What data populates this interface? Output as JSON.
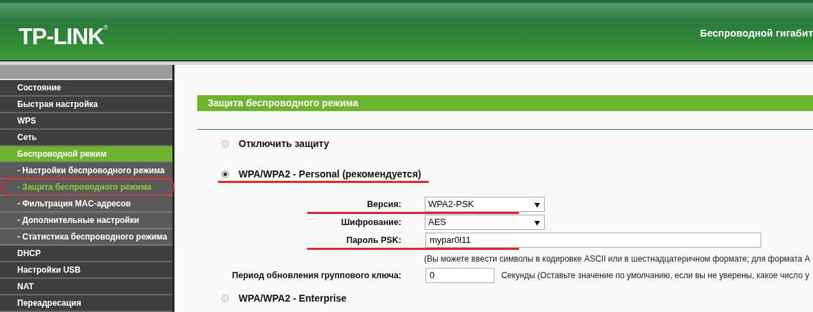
{
  "header": {
    "logo": "TP-LINK",
    "logo_mark": "®",
    "title": "Беспроводной гигабит"
  },
  "sidebar": {
    "items": [
      {
        "label": "Состояние",
        "kind": "main",
        "selected": false,
        "circled": false
      },
      {
        "label": "Быстрая настройка",
        "kind": "main",
        "selected": false,
        "circled": false
      },
      {
        "label": "WPS",
        "kind": "main",
        "selected": false,
        "circled": false
      },
      {
        "label": "Сеть",
        "kind": "main",
        "selected": false,
        "circled": false
      },
      {
        "label": "Беспроводной режим",
        "kind": "main",
        "selected": true,
        "circled": false
      },
      {
        "label": "- Настройки беспроводного режима",
        "kind": "sub",
        "selected": false,
        "circled": false
      },
      {
        "label": "- Защита беспроводного режима",
        "kind": "sub",
        "selected": true,
        "circled": true
      },
      {
        "label": "- Фильтрация MAC-адресов",
        "kind": "sub",
        "selected": false,
        "circled": false
      },
      {
        "label": "- Дополнительные настройки",
        "kind": "sub",
        "selected": false,
        "circled": false
      },
      {
        "label": "- Статистика беспроводного режима",
        "kind": "sub",
        "selected": false,
        "circled": false
      },
      {
        "label": "DHCP",
        "kind": "main",
        "selected": false,
        "circled": false
      },
      {
        "label": "Настройки USB",
        "kind": "main",
        "selected": false,
        "circled": false
      },
      {
        "label": "NAT",
        "kind": "main",
        "selected": false,
        "circled": false
      },
      {
        "label": "Переадресация",
        "kind": "main",
        "selected": false,
        "circled": false
      }
    ]
  },
  "page": {
    "title": "Защита беспроводного режима",
    "options": [
      {
        "label": "Отключить защиту",
        "selected": false,
        "underlined": false
      },
      {
        "label": "WPA/WPA2 - Personal (рекомендуется)",
        "selected": true,
        "underlined": true,
        "fields": [
          {
            "kind": "select",
            "label": "Версия:",
            "value": "WPA2-PSK",
            "underlined": true
          },
          {
            "kind": "select",
            "label": "Шифрование:",
            "value": "AES",
            "underlined": false
          },
          {
            "kind": "text",
            "label": "Пароль PSK:",
            "value": "mypar0l11",
            "underlined": true,
            "hint": "(Вы можете ввести символы в кодировке ASCII или в шестнадцатеричном формате; для формата A"
          },
          {
            "kind": "short",
            "label": "Период обновления группового ключа:",
            "value": "0",
            "underlined": false,
            "suffix": "Секунды (Оставьте значение по умолчанию, если вы не уверены, какое число у"
          }
        ]
      },
      {
        "label": "WPA/WPA2 - Enterprise",
        "selected": false,
        "underlined": false
      }
    ]
  }
}
